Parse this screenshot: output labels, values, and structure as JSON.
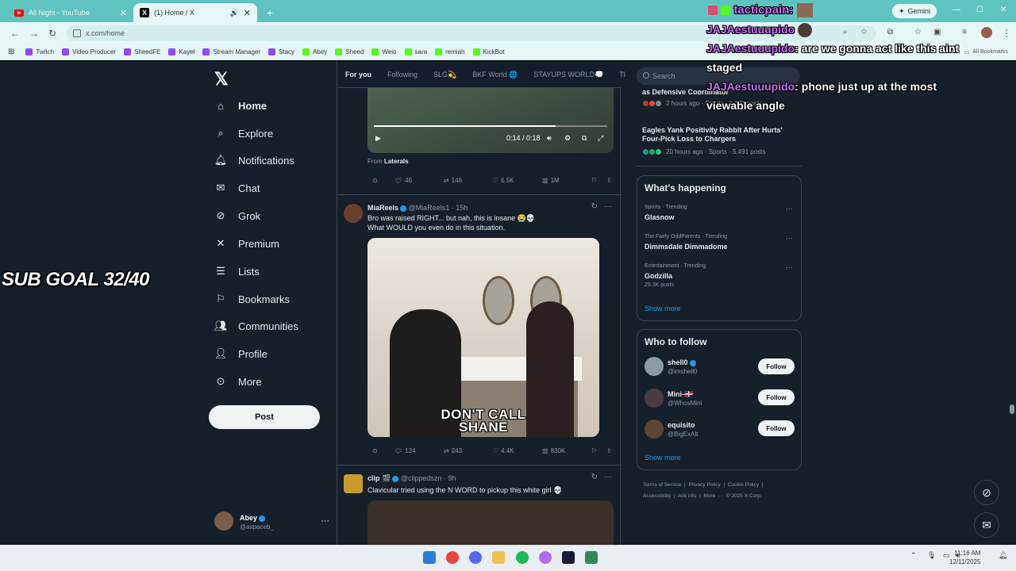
{
  "browser": {
    "tabs": [
      {
        "title": "All Night - YouTube"
      },
      {
        "title": "(1) Home / X"
      }
    ],
    "new_tab": "+",
    "gemini_label": "Gemini",
    "url": "x.com/home",
    "bookmarks": [
      {
        "label": "Twitch",
        "color": "#9146ff"
      },
      {
        "label": "Video Producer",
        "color": "#9146ff"
      },
      {
        "label": "SheedFE",
        "color": "#9146ff"
      },
      {
        "label": "Kayel",
        "color": "#9146ff"
      },
      {
        "label": "Stream Manager",
        "color": "#9146ff"
      },
      {
        "label": "Stacy",
        "color": "#9146ff"
      },
      {
        "label": "Abey",
        "color": "#53fc18"
      },
      {
        "label": "Sheed",
        "color": "#53fc18"
      },
      {
        "label": "Weio",
        "color": "#53fc18"
      },
      {
        "label": "sara",
        "color": "#53fc18"
      },
      {
        "label": "remiah",
        "color": "#53fc18"
      },
      {
        "label": "KickBot",
        "color": "#53fc18"
      }
    ],
    "all_bookmarks": "All Bookmarks"
  },
  "overlay": {
    "sub_goal": "SUB GOAL 32/40",
    "alert_user": "tacticpain:",
    "chat": [
      {
        "user": "JAJAestuuupido",
        "msg": ""
      },
      {
        "user": "JAJAestuuupido",
        "msg": ": are we gonna act like this aint"
      },
      {
        "user": "",
        "msg": "staged"
      },
      {
        "user": "JAJAestuuupido",
        "msg": ": phone just up at the most"
      },
      {
        "user": "",
        "msg": "viewable angle"
      }
    ]
  },
  "nav": {
    "items": [
      {
        "label": "Home",
        "icon": "home-icon"
      },
      {
        "label": "Explore",
        "icon": "search-icon"
      },
      {
        "label": "Notifications",
        "icon": "bell-icon"
      },
      {
        "label": "Chat",
        "icon": "mail-icon"
      },
      {
        "label": "Grok",
        "icon": "grok-icon"
      },
      {
        "label": "Premium",
        "icon": "x-icon"
      },
      {
        "label": "Lists",
        "icon": "list-icon"
      },
      {
        "label": "Bookmarks",
        "icon": "bookmark-icon"
      },
      {
        "label": "Communities",
        "icon": "people-icon"
      },
      {
        "label": "Profile",
        "icon": "person-icon"
      },
      {
        "label": "More",
        "icon": "more-circle-icon"
      }
    ],
    "post_button": "Post",
    "account": {
      "name": "Abey",
      "handle": "@aspaceb_"
    }
  },
  "feed": {
    "tabs": [
      "For you",
      "Following",
      "SLG💫",
      "BKF World 🌐",
      "STAYUPS WORLD💭",
      "Tl"
    ],
    "post1": {
      "video_time": "0:14 / 0:18",
      "video_progress": 0.78,
      "from_label": "From",
      "from_source": "Laterals",
      "replies": "46",
      "reposts": "146",
      "likes": "6.5K",
      "views": "1M"
    },
    "post2": {
      "name": "MiaReels",
      "handle": "@MiaReels1 · 15h",
      "text_line1": "Bro was raised RIGHT... but nah, this is insane 😭💀",
      "text_line2": "What WOULD you even do in this situation.",
      "caption_line1": "DON'T CALL",
      "caption_line2": "SHANE",
      "replies": "124",
      "reposts": "243",
      "likes": "4.4K",
      "views": "830K"
    },
    "post3": {
      "name": "clip 🎬",
      "handle": "@clippedszn · 9h",
      "text": "Clavicular tried using the N WORD to pickup this white girl 💀"
    }
  },
  "sidebar": {
    "search_placeholder": "Search",
    "news": [
      {
        "title": "as Defensive Coordinator",
        "meta": "2 hours ago · Sports · 1,171 posts"
      },
      {
        "title": "Eagles Yank Positivity Rabbit After Hurts' Four-Pick Loss to Chargers",
        "meta": "20 hours ago · Sports · 5,491 posts"
      }
    ],
    "whats_happening": {
      "title": "What's happening",
      "trends": [
        {
          "context": "Sports · Trending",
          "name": "Glasnow",
          "count": ""
        },
        {
          "context": "The Fairly OddParents · Trending",
          "name": "Dimmsdale Dimmadome",
          "count": ""
        },
        {
          "context": "Entertainment · Trending",
          "name": "Godzilla",
          "count": "29.3K posts"
        }
      ],
      "show_more": "Show more"
    },
    "who_to_follow": {
      "title": "Who to follow",
      "accounts": [
        {
          "name": "shell0",
          "handle": "@imshell0",
          "follow": "Follow"
        },
        {
          "name": "Mini-🇩🇴",
          "handle": "@WhosMini",
          "follow": "Follow"
        },
        {
          "name": "equisito",
          "handle": "@BigExAlt",
          "follow": "Follow"
        }
      ],
      "show_more": "Show more"
    },
    "footer": {
      "links": [
        "Terms of Service",
        "Privacy Policy",
        "Cookie Policy",
        "Accessibility",
        "Ads info",
        "More ···"
      ],
      "copyright": "© 2025 X Corp."
    }
  },
  "taskbar": {
    "time": "11:16 AM",
    "date": "12/11/2025"
  }
}
